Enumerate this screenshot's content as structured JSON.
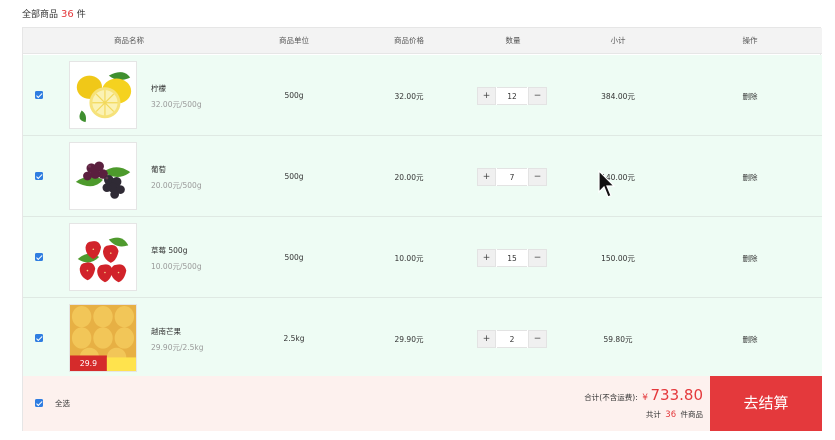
{
  "summary": {
    "label": "全部商品",
    "count": "36",
    "unit": "件"
  },
  "header": {
    "col_name": "商品名称",
    "col_unit": "商品单位",
    "col_price": "商品价格",
    "col_qty": "数量",
    "col_subtotal": "小计",
    "col_action": "操作"
  },
  "items": [
    {
      "name": "柠檬",
      "unit_price": "32.00元/500g",
      "unit": "500g",
      "price": "32.00元",
      "qty": "12",
      "subtotal": "384.00元",
      "action": "删除",
      "icon": "lemon-image"
    },
    {
      "name": "葡萄",
      "unit_price": "20.00元/500g",
      "unit": "500g",
      "price": "20.00元",
      "qty": "7",
      "subtotal": "140.00元",
      "action": "删除",
      "icon": "grape-image"
    },
    {
      "name": "草莓 500g",
      "unit_price": "10.00元/500g",
      "unit": "500g",
      "price": "10.00元",
      "qty": "15",
      "subtotal": "150.00元",
      "action": "删除",
      "icon": "strawberry-image"
    },
    {
      "name": "越南芒果",
      "unit_price": "29.90元/2.5kg",
      "unit": "2.5kg",
      "price": "29.90元",
      "qty": "2",
      "subtotal": "59.80元",
      "action": "删除",
      "icon": "mango-image",
      "badge_text": "29.9"
    }
  ],
  "buttons": {
    "plus": "+",
    "minus": "−"
  },
  "footer": {
    "select_all": "全选",
    "total_label": "合计(不含运费):",
    "currency": "¥",
    "total_value": "733.80",
    "count_prefix": "共计",
    "count_value": "36",
    "count_suffix": "件商品",
    "checkout": "去结算"
  },
  "colors": {
    "accent": "#e4393c",
    "checkbox": "#2f7de1",
    "row_bg": "#eefcf4",
    "footer_bg": "#fdf1ee"
  }
}
